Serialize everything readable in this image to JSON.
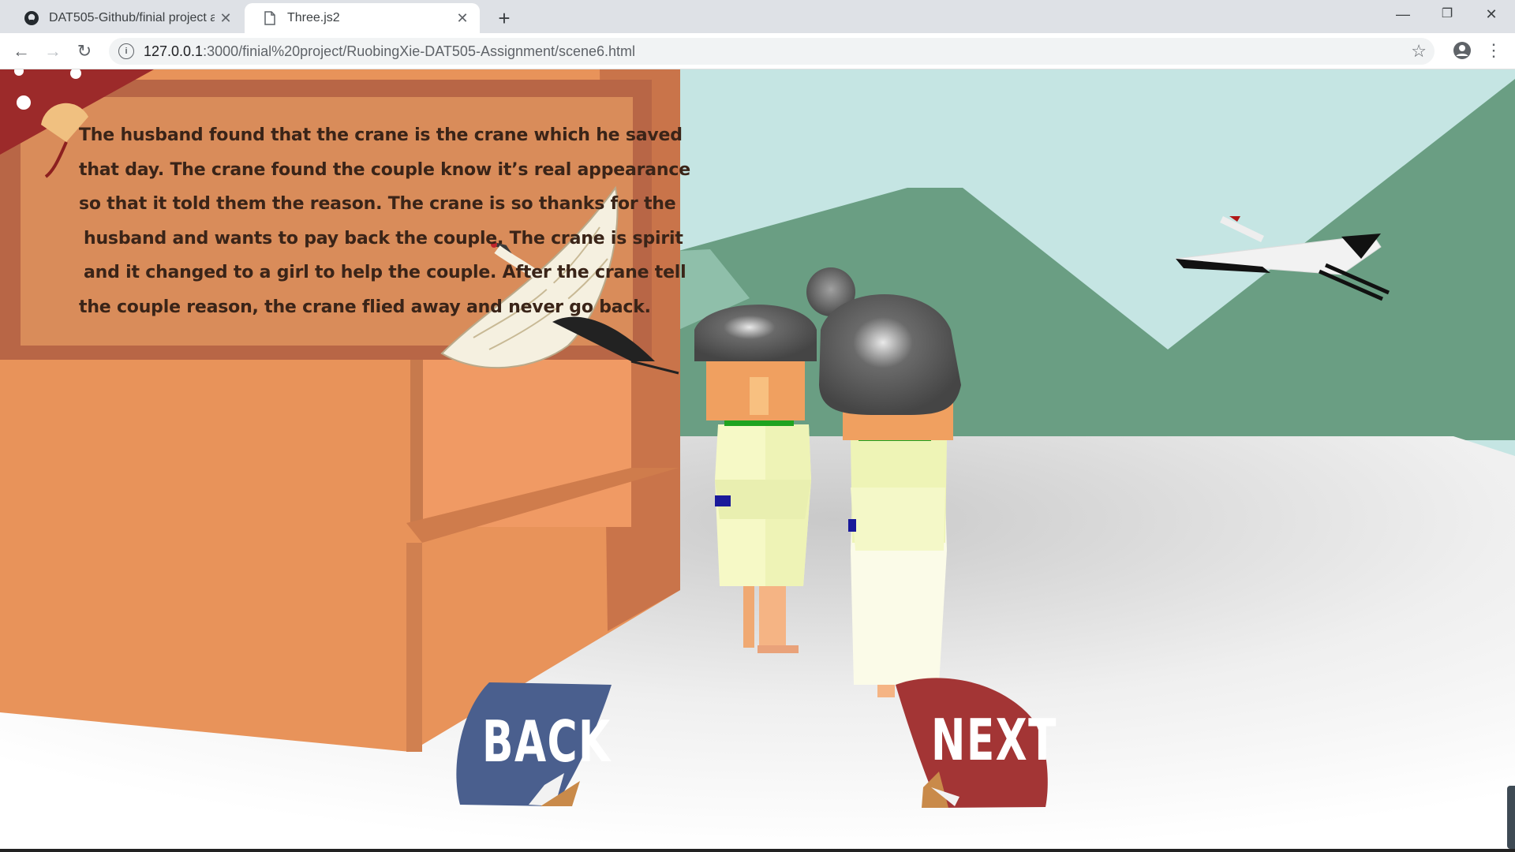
{
  "browser": {
    "tabs": [
      {
        "title": "DAT505-Github/finial project a",
        "icon": "github-icon",
        "active": false
      },
      {
        "title": "Three.js2",
        "icon": "page-icon",
        "active": true
      }
    ],
    "new_tab_symbol": "+",
    "url_host": "127.0.0.1",
    "url_path": ":3000/finial%20project/RuobingXie-DAT505-Assignment/scene6.html",
    "window_controls": {
      "minimize": "—",
      "restore": "❐",
      "close": "✕"
    }
  },
  "scene": {
    "story_lines": [
      "The husband found that the crane is the crane which he saved",
      "that day. The crane found the couple know it’s real appearance",
      "so that it told them the reason. The crane is so thanks for the",
      "husband and wants to pay back the couple. The crane is spirit",
      "and it changed to a girl to help the couple. After the crane tell",
      "the couple reason, the crane flied away and never go back."
    ],
    "back_label": "BACK",
    "next_label": "NEXT",
    "colors": {
      "sky": "#c5e5e3",
      "mountain": "#6a9e83",
      "panel": "#d98c5a",
      "wall": "#e8935a",
      "back_fan": "#4a5f8e",
      "next_fan": "#a33535",
      "banner": "#9c2a2a"
    }
  }
}
